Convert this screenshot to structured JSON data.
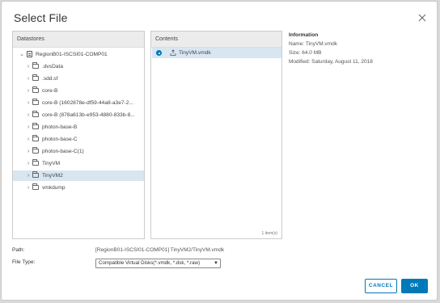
{
  "dialog": {
    "title": "Select File"
  },
  "datastores": {
    "header": "Datastores",
    "root": {
      "label": "RegionB01-ISCSI01-COMP01",
      "expanded": true
    },
    "items": [
      {
        "label": ".dvsData"
      },
      {
        "label": ".sdd.sf"
      },
      {
        "label": "core-B"
      },
      {
        "label": "core-B (1602878e-df59-44a8-a3e7-2..."
      },
      {
        "label": "core-B (878a613b-e953-4880-833b-8..."
      },
      {
        "label": "photon-base-B"
      },
      {
        "label": "photon-base-C"
      },
      {
        "label": "photon-base-C(1)"
      },
      {
        "label": "TinyVM"
      },
      {
        "label": "TinyVM2",
        "selected": true
      },
      {
        "label": "vmkdump"
      }
    ]
  },
  "contents": {
    "header": "Contents",
    "items": [
      {
        "label": "TinyVM.vmdk",
        "selected": true
      }
    ],
    "count": "1 item(s)"
  },
  "information": {
    "title": "Information",
    "name": "Name: TinyVM.vmdk",
    "size": "Size: 64.0 MB",
    "modified": "Modified: Saturday, August 11, 2018"
  },
  "footer": {
    "path_label": "Path:",
    "path_value": "[RegionB01-ISCSI01-COMP01] TinyVM2/TinyVM.vmdk",
    "filetype_label": "File Type:",
    "filetype_value": "Compatible Virtual Disks(*.vmdk, *.dsk, *.raw)"
  },
  "buttons": {
    "cancel": "CANCEL",
    "ok": "OK"
  },
  "colors": {
    "accent": "#0079b8",
    "selection": "#d7e6f1"
  }
}
